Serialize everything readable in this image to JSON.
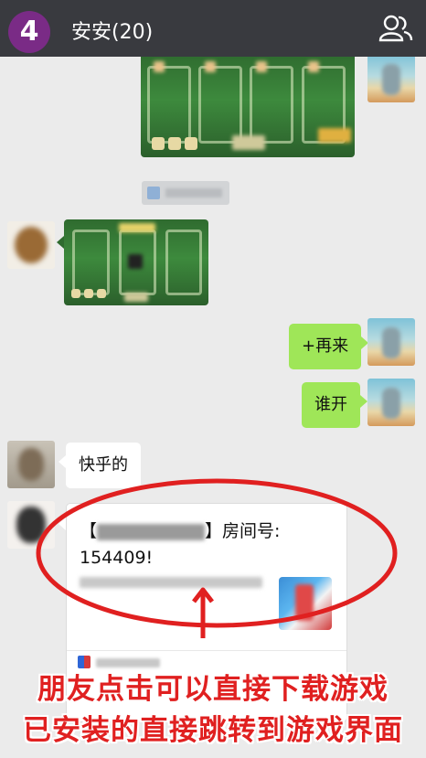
{
  "header": {
    "step_number": "4",
    "title": "安安(20)",
    "members_icon": "group-members-icon"
  },
  "messages": [
    {
      "side": "right",
      "type": "image",
      "content": "game-screenshot"
    },
    {
      "side": "center",
      "type": "source-tag",
      "content": "blurred"
    },
    {
      "side": "left",
      "type": "image",
      "content": "game-screenshot"
    },
    {
      "side": "right",
      "type": "text",
      "text": "+再来"
    },
    {
      "side": "right",
      "type": "text",
      "text": "谁开"
    },
    {
      "side": "left",
      "type": "text",
      "text": "快乎的"
    }
  ],
  "invite_card": {
    "bracket_open": "【",
    "bracket_close": "】",
    "room_label": "房间号:",
    "room_number": "154409!"
  },
  "annotation": {
    "line1": "朋友点击可以直接下载游戏",
    "line2": "已安装的直接跳转到游戏界面",
    "color": "#e02020"
  }
}
